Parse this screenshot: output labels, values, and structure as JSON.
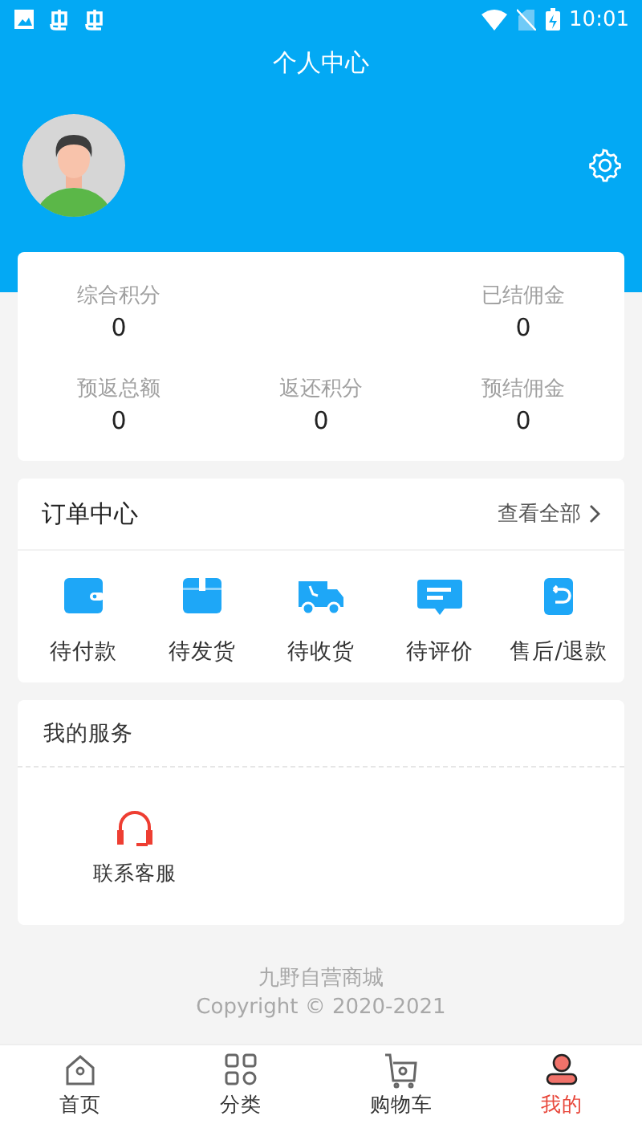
{
  "status_bar": {
    "time": "10:01"
  },
  "header": {
    "title": "个人中心"
  },
  "stat_rows": [
    {
      "left": {
        "label": "综合积分",
        "value": "0"
      },
      "right": {
        "label": "已结佣金",
        "value": "0"
      }
    },
    {
      "left": {
        "label": "预返总额",
        "value": "0"
      },
      "center": {
        "label": "返还积分",
        "value": "0"
      },
      "right": {
        "label": "预结佣金",
        "value": "0"
      }
    }
  ],
  "orders": {
    "title": "订单中心",
    "view_all": "查看全部",
    "items": [
      {
        "label": "待付款",
        "kind": "wallet"
      },
      {
        "label": "待发货",
        "kind": "box"
      },
      {
        "label": "待收货",
        "kind": "truck"
      },
      {
        "label": "待评价",
        "kind": "comment"
      },
      {
        "label": "售后/退款",
        "kind": "refund"
      }
    ]
  },
  "services": {
    "title": "我的服务",
    "items": [
      {
        "label": "联系客服",
        "kind": "headset"
      }
    ]
  },
  "footer": {
    "name": "九野自营商城",
    "copyright": "Copyright © 2020-2021"
  },
  "tab_bar": [
    {
      "label": "首页",
      "kind": "home",
      "selected": false
    },
    {
      "label": "分类",
      "kind": "grid",
      "selected": false
    },
    {
      "label": "购物车",
      "kind": "cart",
      "selected": false
    },
    {
      "label": "我的",
      "kind": "user",
      "selected": true
    }
  ]
}
